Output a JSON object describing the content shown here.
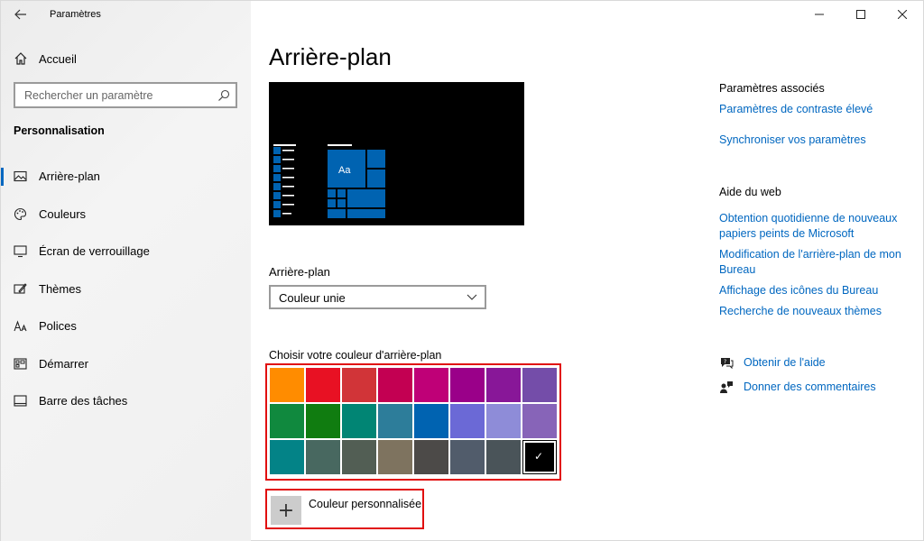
{
  "window": {
    "title": "Paramètres"
  },
  "sidebar": {
    "home_label": "Accueil",
    "search_placeholder": "Rechercher un paramètre",
    "section_title": "Personnalisation",
    "items": [
      {
        "label": "Arrière-plan",
        "icon": "picture-icon",
        "active": true
      },
      {
        "label": "Couleurs",
        "icon": "palette-icon",
        "active": false
      },
      {
        "label": "Écran de verrouillage",
        "icon": "lock-screen-icon",
        "active": false
      },
      {
        "label": "Thèmes",
        "icon": "themes-icon",
        "active": false
      },
      {
        "label": "Polices",
        "icon": "fonts-icon",
        "active": false
      },
      {
        "label": "Démarrer",
        "icon": "start-icon",
        "active": false
      },
      {
        "label": "Barre des tâches",
        "icon": "taskbar-icon",
        "active": false
      }
    ]
  },
  "main": {
    "title": "Arrière-plan",
    "preview": {
      "tile_text": "Aa",
      "accent": "#0063b1"
    },
    "background_label": "Arrière-plan",
    "background_select_value": "Couleur unie",
    "color_label": "Choisir votre couleur d'arrière-plan",
    "swatches": [
      "#ff8c00",
      "#e81123",
      "#d13438",
      "#c30052",
      "#bf0077",
      "#9a0089",
      "#881798",
      "#744da9",
      "#10893e",
      "#107c10",
      "#018574",
      "#2d7d9a",
      "#0063b1",
      "#6b69d6",
      "#8e8cd8",
      "#8764b8",
      "#038387",
      "#486860",
      "#525e54",
      "#7e735f",
      "#4c4a48",
      "#515c6b",
      "#4a5459",
      "#000000"
    ],
    "selected_swatch_index": 23,
    "custom_color_label": "Couleur personnalisée"
  },
  "related": {
    "heading": "Paramètres associés",
    "links": [
      "Paramètres de contraste élevé",
      "Synchroniser vos paramètres"
    ]
  },
  "web_help": {
    "heading": "Aide du web",
    "links": [
      "Obtention quotidienne de nouveaux papiers peints de Microsoft",
      "Modification de l'arrière-plan de mon Bureau",
      "Affichage des icônes du Bureau",
      "Recherche de nouveaux thèmes"
    ]
  },
  "help": {
    "get_help": "Obtenir de l'aide",
    "feedback": "Donner des commentaires"
  },
  "colors": {
    "link": "#0067c0",
    "highlight_border": "#e10f0f"
  }
}
